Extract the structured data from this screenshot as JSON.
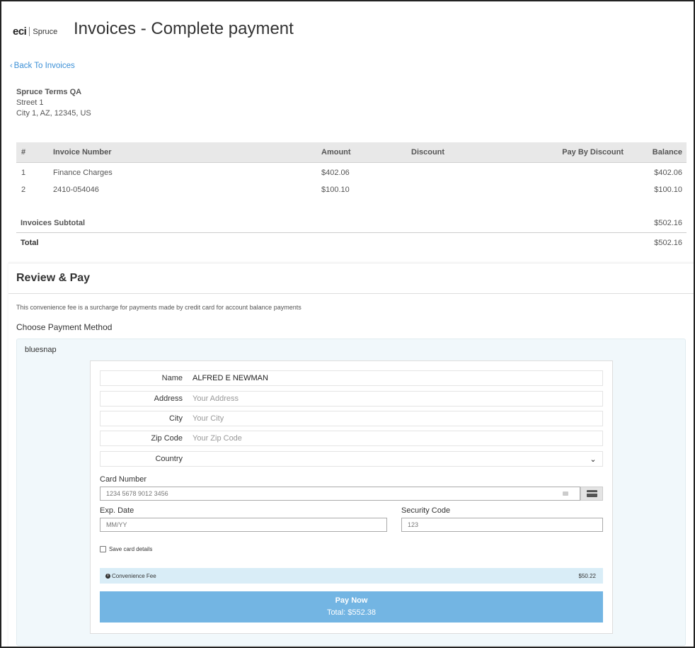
{
  "brand": {
    "eci": "eci",
    "spruce": "Spruce"
  },
  "page_title": "Invoices - Complete payment",
  "back_link": "Back To Invoices",
  "customer": {
    "name": "Spruce Terms QA",
    "street": "Street 1",
    "city_line": "City 1, AZ, 12345, US"
  },
  "invoice_table": {
    "headers": [
      "#",
      "Invoice Number",
      "Amount",
      "Discount",
      "Pay By Discount",
      "Balance"
    ],
    "rows": [
      [
        "1",
        "Finance Charges",
        "$402.06",
        "",
        "",
        "$402.06"
      ],
      [
        "2",
        "2410-054046",
        "$100.10",
        "",
        "",
        "$100.10"
      ]
    ]
  },
  "totals": {
    "subtotal_label": "Invoices Subtotal",
    "subtotal_value": "$502.16",
    "total_label": "Total",
    "total_value": "$502.16"
  },
  "review": {
    "title": "Review & Pay",
    "fee_note": "This convenience fee is a surcharge for payments made by credit card for account balance payments",
    "choose_label": "Choose Payment Method",
    "method_name": "bluesnap"
  },
  "form": {
    "name_label": "Name",
    "name_value": "ALFRED E NEWMAN",
    "address_label": "Address",
    "address_placeholder": "Your Address",
    "city_label": "City",
    "city_placeholder": "Your City",
    "zip_label": "Zip Code",
    "zip_placeholder": "Your Zip Code",
    "country_label": "Country",
    "country_value": "",
    "card_number_label": "Card Number",
    "card_number_placeholder": "1234 5678 9012 3456",
    "exp_label": "Exp. Date",
    "exp_placeholder": "MM/YY",
    "cvv_label": "Security Code",
    "cvv_placeholder": "123",
    "save_label": "Save card details"
  },
  "convenience_fee": {
    "label": "Convenience Fee",
    "value": "$50.22"
  },
  "pay_button": {
    "label": "Pay Now",
    "total": "Total: $552.38"
  }
}
